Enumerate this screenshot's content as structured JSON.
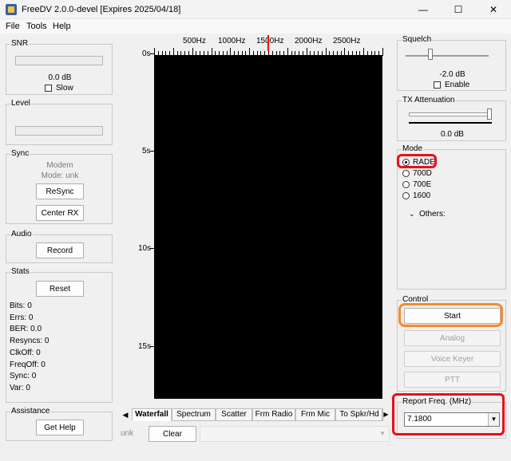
{
  "window": {
    "title": "FreeDV 2.0.0-devel [Expires 2025/04/18]",
    "minimize": "—",
    "maximize": "☐",
    "close": "✕"
  },
  "menu": {
    "file": "File",
    "tools": "Tools",
    "help": "Help"
  },
  "snr": {
    "label": "SNR",
    "value": "0.0 dB",
    "slow_label": "Slow"
  },
  "level": {
    "label": "Level"
  },
  "sync": {
    "label": "Sync",
    "modem": "Modem",
    "mode": "Mode: unk",
    "resync": "ReSync",
    "center_rx": "Center RX"
  },
  "audio": {
    "label": "Audio",
    "record": "Record"
  },
  "stats": {
    "label": "Stats",
    "reset": "Reset",
    "lines": [
      "Bits: 0",
      "Errs: 0",
      "BER: 0.0",
      "Resyncs: 0",
      "ClkOff: 0",
      "FreqOff: 0",
      "Sync: 0",
      "Var: 0"
    ]
  },
  "assistance": {
    "label": "Assistance",
    "get_help": "Get Help"
  },
  "waterfall": {
    "freq_labels": [
      "500Hz",
      "1000Hz",
      "1500Hz",
      "2000Hz",
      "2500Hz"
    ],
    "time_labels": [
      "0s",
      "5s",
      "10s",
      "15s"
    ]
  },
  "tabs": [
    "Waterfall",
    "Spectrum",
    "Scatter",
    "Frm Radio",
    "Frm Mic",
    "To Spkr/Hd"
  ],
  "bottom": {
    "status": "unk",
    "clear": "Clear"
  },
  "squelch": {
    "label": "Squelch",
    "value": "-2.0 dB",
    "enable_label": "Enable",
    "level": 0.3
  },
  "tx_atten": {
    "label": "TX Attenuation",
    "value": "0.0 dB",
    "level": 1.0
  },
  "mode": {
    "label": "Mode",
    "options": [
      "RADE",
      "700D",
      "700E",
      "1600"
    ],
    "selected": "RADE",
    "others": "Others:"
  },
  "control": {
    "label": "Control",
    "start": "Start",
    "analog": "Analog",
    "voice_keyer": "Voice Keyer",
    "ptt": "PTT"
  },
  "report": {
    "label": "Report Freq. (MHz)",
    "value": "7.1800"
  },
  "colors": {
    "highlight_red": "#e8101a",
    "highlight_orange": "#f58a2c",
    "marker_red": "#ff0000"
  }
}
